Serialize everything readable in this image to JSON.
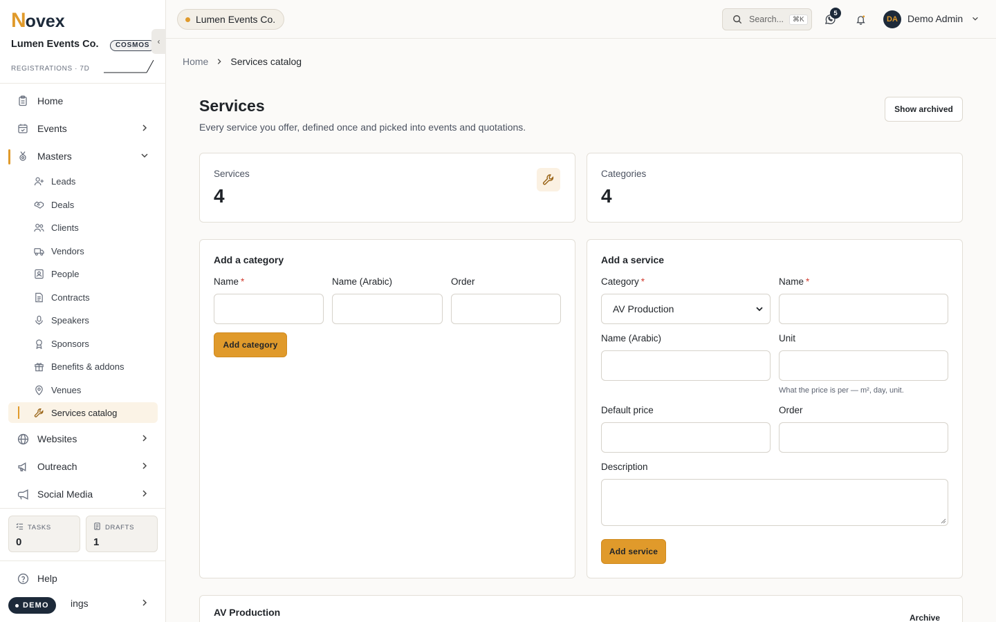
{
  "brand": {
    "first_letter": "N",
    "rest": "ovex"
  },
  "org": {
    "name": "Lumen Events Co.",
    "badge": "COSMOS"
  },
  "sidebar": {
    "collapse_glyph": "‹",
    "registrations_label": "REGISTRATIONS · 7D",
    "nav": {
      "home": "Home",
      "events": "Events",
      "masters": "Masters",
      "websites": "Websites",
      "outreach": "Outreach",
      "social_media": "Social Media"
    },
    "masters_items": [
      {
        "label": "Leads",
        "icon": "user-plus-icon"
      },
      {
        "label": "Deals",
        "icon": "handshake-icon"
      },
      {
        "label": "Clients",
        "icon": "users-icon"
      },
      {
        "label": "Vendors",
        "icon": "truck-icon"
      },
      {
        "label": "People",
        "icon": "id-card-icon"
      },
      {
        "label": "Contracts",
        "icon": "file-text-icon"
      },
      {
        "label": "Speakers",
        "icon": "microphone-icon"
      },
      {
        "label": "Sponsors",
        "icon": "award-icon"
      },
      {
        "label": "Benefits & addons",
        "icon": "gift-icon"
      },
      {
        "label": "Venues",
        "icon": "map-pin-icon"
      },
      {
        "label": "Services catalog",
        "icon": "wrench-icon",
        "active": true
      }
    ],
    "tasks": {
      "label": "TASKS",
      "value": "0"
    },
    "drafts": {
      "label": "DRAFTS",
      "value": "1"
    },
    "help": "Help",
    "settings_partial": "ings",
    "demo": "DEMO"
  },
  "topbar": {
    "tenant": "Lumen Events Co.",
    "search_label": "Search...",
    "search_shortcut": "⌘K",
    "messages_count": "5",
    "user_initials": "DA",
    "user_name": "Demo Admin"
  },
  "breadcrumb": {
    "home": "Home",
    "current": "Services catalog"
  },
  "page": {
    "title": "Services",
    "subtitle": "Every service you offer, defined once and picked into events and quotations.",
    "show_archived": "Show archived"
  },
  "stats": {
    "services": {
      "label": "Services",
      "value": "4"
    },
    "categories": {
      "label": "Categories",
      "value": "4"
    }
  },
  "add_category": {
    "title": "Add a category",
    "name_label": "Name",
    "name_arabic_label": "Name (Arabic)",
    "order_label": "Order",
    "required_mark": "*",
    "button": "Add category"
  },
  "add_service": {
    "title": "Add a service",
    "category_label": "Category",
    "category_value": "AV Production",
    "name_label": "Name",
    "name_arabic_label": "Name (Arabic)",
    "unit_label": "Unit",
    "unit_hint": "What the price is per — m², day, unit.",
    "default_price_label": "Default price",
    "order_label": "Order",
    "description_label": "Description",
    "required_mark": "*",
    "button": "Add service"
  },
  "category_section": {
    "title": "AV Production",
    "archive": "Archive"
  },
  "colors": {
    "accent": "#e09a2b",
    "navy": "#1d2a3a",
    "background": "#fbfaf8"
  }
}
